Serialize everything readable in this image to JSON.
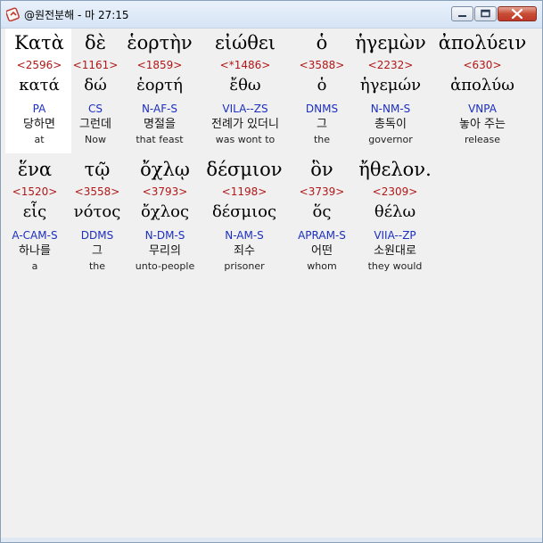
{
  "window": {
    "title": "@원전분해 - 마 27:15",
    "icon": "bible-app-icon",
    "controls": [
      "minimize-icon",
      "maximize-icon",
      "close-icon"
    ]
  },
  "rows": [
    {
      "words": [
        {
          "greek": "Κατὰ",
          "strong": "<2596>",
          "lemma": "κατά",
          "parse": "PA",
          "korean": "당하면",
          "english": "at"
        },
        {
          "greek": "δὲ",
          "strong": "<1161>",
          "lemma": "δώ",
          "parse": "CS",
          "korean": "그런데",
          "english": "Now"
        },
        {
          "greek": "ἑορτὴν",
          "strong": "<1859>",
          "lemma": "ἑορτή",
          "parse": "N-AF-S",
          "korean": "명절을",
          "english": "that feast"
        },
        {
          "greek": "εἰώθει",
          "strong": "<*1486>",
          "lemma": "ἔθω",
          "parse": "VILA--ZS",
          "korean": "전례가 있더니",
          "english": "was wont to"
        },
        {
          "greek": "ὁ",
          "strong": "<3588>",
          "lemma": "ὁ",
          "parse": "DNMS",
          "korean": "그",
          "english": "the"
        },
        {
          "greek": "ἡγεμὼν",
          "strong": "<2232>",
          "lemma": "ἡγεμών",
          "parse": "N-NM-S",
          "korean": "총독이",
          "english": "governor"
        },
        {
          "greek": "ἀπολύειν",
          "strong": "<630>",
          "lemma": "ἀπολύω",
          "parse": "VNPA",
          "korean": "놓아 주는",
          "english": "release"
        }
      ]
    },
    {
      "words": [
        {
          "greek": "ἕνα",
          "strong": "<1520>",
          "lemma": "εἷς",
          "parse": "A-CAM-S",
          "korean": "하나를",
          "english": "a"
        },
        {
          "greek": "τῷ",
          "strong": "<3558>",
          "lemma": "νότος",
          "parse": "DDMS",
          "korean": "그",
          "english": "the"
        },
        {
          "greek": "ὄχλῳ",
          "strong": "<3793>",
          "lemma": "ὄχλος",
          "parse": "N-DM-S",
          "korean": "무리의",
          "english": "unto-people"
        },
        {
          "greek": "δέσμιον",
          "strong": "<1198>",
          "lemma": "δέσμιος",
          "parse": "N-AM-S",
          "korean": "죄수",
          "english": "prisoner"
        },
        {
          "greek": "ὃν",
          "strong": "<3739>",
          "lemma": "ὅς",
          "parse": "APRAM-S",
          "korean": "어떤",
          "english": "whom"
        },
        {
          "greek": "ἤθελον.",
          "strong": "<2309>",
          "lemma": "θέλω",
          "parse": "VIIA--ZP",
          "korean": "소원대로",
          "english": "they would"
        }
      ]
    }
  ]
}
